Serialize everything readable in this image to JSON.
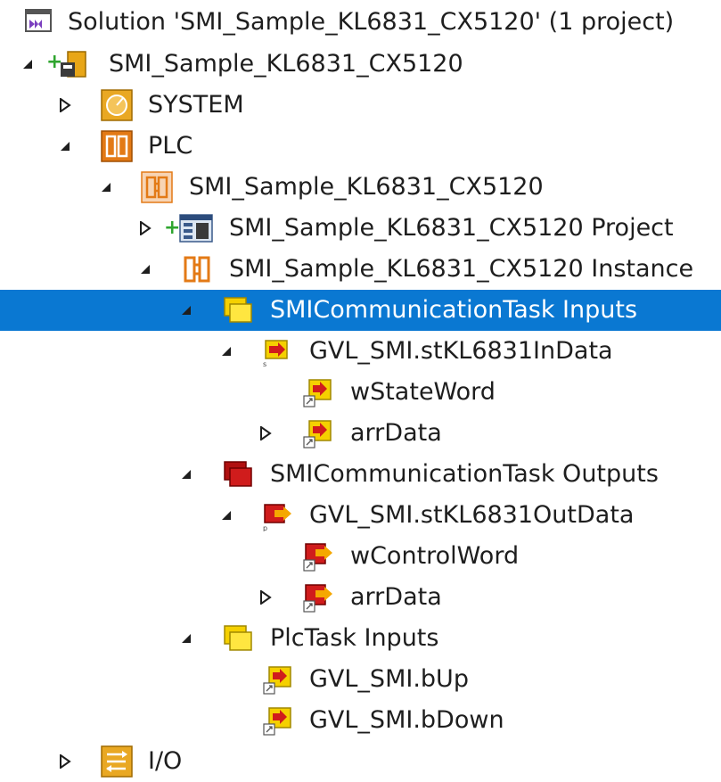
{
  "solution": {
    "label": "Solution 'SMI_Sample_KL6831_CX5120' (1 project)"
  },
  "project": {
    "label": "SMI_Sample_KL6831_CX5120"
  },
  "system": {
    "label": "SYSTEM"
  },
  "plc": {
    "label": "PLC"
  },
  "plc_project": {
    "label": "SMI_Sample_KL6831_CX5120"
  },
  "plc_project_sub": {
    "label": "SMI_Sample_KL6831_CX5120 Project"
  },
  "plc_instance": {
    "label": "SMI_Sample_KL6831_CX5120 Instance"
  },
  "comm_inputs": {
    "label": "SMICommunicationTask Inputs"
  },
  "in_data": {
    "label": "GVL_SMI.stKL6831InData"
  },
  "in_state": {
    "label": "wStateWord"
  },
  "in_arr": {
    "label": "arrData"
  },
  "comm_outputs": {
    "label": "SMICommunicationTask Outputs"
  },
  "out_data": {
    "label": "GVL_SMI.stKL6831OutData"
  },
  "out_control": {
    "label": "wControlWord"
  },
  "out_arr": {
    "label": "arrData"
  },
  "plctask_inputs": {
    "label": "PlcTask Inputs"
  },
  "bup": {
    "label": "GVL_SMI.bUp"
  },
  "bdown": {
    "label": "GVL_SMI.bDown"
  },
  "io": {
    "label": "I/O"
  },
  "colors": {
    "selection": "#0a78d2",
    "text": "#1e1e1e",
    "input_yellow": "#f5d000",
    "output_red": "#d01c1c"
  }
}
